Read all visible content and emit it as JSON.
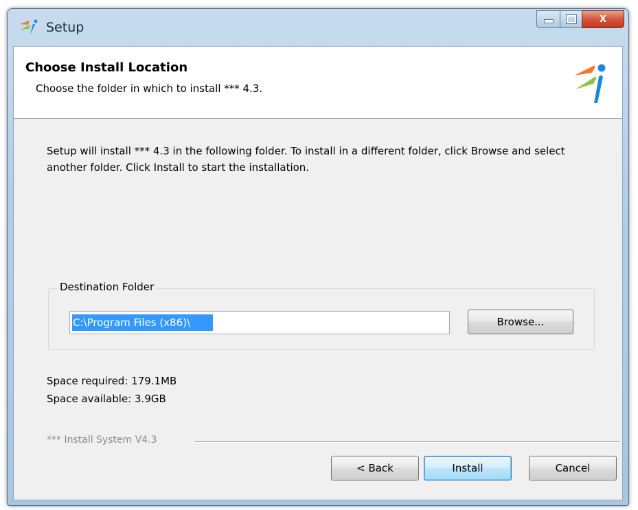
{
  "window": {
    "title": "Setup",
    "app_icon": "setup-logo-icon",
    "controls": {
      "minimize": "minimize-icon",
      "maximize": "maximize-icon",
      "close_label": "X"
    }
  },
  "header": {
    "title": "Choose Install Location",
    "subtitle": "Choose the folder in which to install *** 4.3.",
    "logo": "product-logo-icon"
  },
  "intro_text": "Setup will install  ***   4.3 in the following folder. To install in a different folder, click Browse and select another folder. Click Install to start the installation.",
  "destination": {
    "label": "Destination Folder",
    "path": "C:\\Program Files (x86)\\",
    "browse_label": "Browse..."
  },
  "space": {
    "required": "Space required: 179.1MB",
    "available": "Space available: 3.9GB"
  },
  "branding": "*** Install System V4.3",
  "buttons": {
    "back": "< Back",
    "install": "Install",
    "cancel": "Cancel"
  },
  "colors": {
    "selection": "#3399ff",
    "close_button": "#c03a1f",
    "logo_orange": "#f07a2a",
    "logo_green": "#8cc63f",
    "logo_blue": "#1e88d8"
  }
}
